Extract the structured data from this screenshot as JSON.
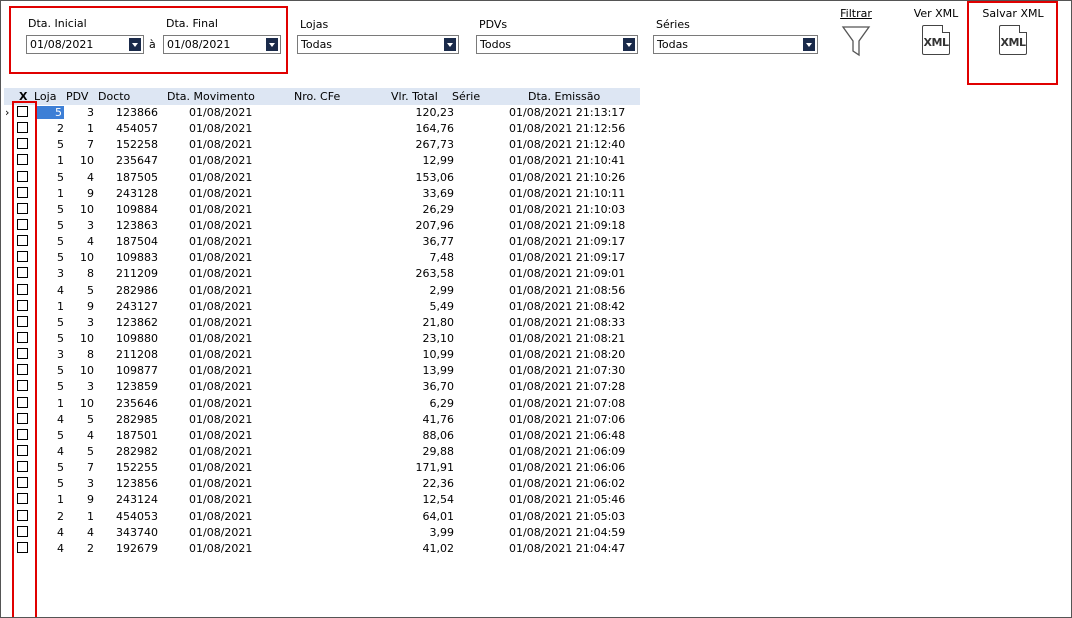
{
  "filters": {
    "dta_inicial_label": "Dta. Inicial",
    "dta_inicial_value": "01/08/2021",
    "separator": "à",
    "dta_final_label": "Dta. Final",
    "dta_final_value": "01/08/2021",
    "lojas_label": "Lojas",
    "lojas_value": "Todas",
    "pdvs_label": "PDVs",
    "pdvs_value": "Todos",
    "series_label": "Séries",
    "series_value": "Todas"
  },
  "toolbar": {
    "filtrar": "Filtrar",
    "ver_xml": "Ver XML",
    "salvar_xml": "Salvar XML",
    "icon_text": "XML"
  },
  "grid": {
    "headers": {
      "x": "X",
      "loja": "Loja",
      "pdv": "PDV",
      "docto": "Docto",
      "dta_movimento": "Dta. Movimento",
      "nro_cfe": "Nro. CFe",
      "vlr_total": "Vlr. Total",
      "serie": "Série",
      "dta_emissao": "Dta. Emissão"
    },
    "rows": [
      {
        "loja": "5",
        "pdv": "3",
        "docto": "123866",
        "mov": "01/08/2021",
        "total": "120,23",
        "emissao": "01/08/2021 21:13:17"
      },
      {
        "loja": "2",
        "pdv": "1",
        "docto": "454057",
        "mov": "01/08/2021",
        "total": "164,76",
        "emissao": "01/08/2021 21:12:56"
      },
      {
        "loja": "5",
        "pdv": "7",
        "docto": "152258",
        "mov": "01/08/2021",
        "total": "267,73",
        "emissao": "01/08/2021 21:12:40"
      },
      {
        "loja": "1",
        "pdv": "10",
        "docto": "235647",
        "mov": "01/08/2021",
        "total": "12,99",
        "emissao": "01/08/2021 21:10:41"
      },
      {
        "loja": "5",
        "pdv": "4",
        "docto": "187505",
        "mov": "01/08/2021",
        "total": "153,06",
        "emissao": "01/08/2021 21:10:26"
      },
      {
        "loja": "1",
        "pdv": "9",
        "docto": "243128",
        "mov": "01/08/2021",
        "total": "33,69",
        "emissao": "01/08/2021 21:10:11"
      },
      {
        "loja": "5",
        "pdv": "10",
        "docto": "109884",
        "mov": "01/08/2021",
        "total": "26,29",
        "emissao": "01/08/2021 21:10:03"
      },
      {
        "loja": "5",
        "pdv": "3",
        "docto": "123863",
        "mov": "01/08/2021",
        "total": "207,96",
        "emissao": "01/08/2021 21:09:18"
      },
      {
        "loja": "5",
        "pdv": "4",
        "docto": "187504",
        "mov": "01/08/2021",
        "total": "36,77",
        "emissao": "01/08/2021 21:09:17"
      },
      {
        "loja": "5",
        "pdv": "10",
        "docto": "109883",
        "mov": "01/08/2021",
        "total": "7,48",
        "emissao": "01/08/2021 21:09:17"
      },
      {
        "loja": "3",
        "pdv": "8",
        "docto": "211209",
        "mov": "01/08/2021",
        "total": "263,58",
        "emissao": "01/08/2021 21:09:01"
      },
      {
        "loja": "4",
        "pdv": "5",
        "docto": "282986",
        "mov": "01/08/2021",
        "total": "2,99",
        "emissao": "01/08/2021 21:08:56"
      },
      {
        "loja": "1",
        "pdv": "9",
        "docto": "243127",
        "mov": "01/08/2021",
        "total": "5,49",
        "emissao": "01/08/2021 21:08:42"
      },
      {
        "loja": "5",
        "pdv": "3",
        "docto": "123862",
        "mov": "01/08/2021",
        "total": "21,80",
        "emissao": "01/08/2021 21:08:33"
      },
      {
        "loja": "5",
        "pdv": "10",
        "docto": "109880",
        "mov": "01/08/2021",
        "total": "23,10",
        "emissao": "01/08/2021 21:08:21"
      },
      {
        "loja": "3",
        "pdv": "8",
        "docto": "211208",
        "mov": "01/08/2021",
        "total": "10,99",
        "emissao": "01/08/2021 21:08:20"
      },
      {
        "loja": "5",
        "pdv": "10",
        "docto": "109877",
        "mov": "01/08/2021",
        "total": "13,99",
        "emissao": "01/08/2021 21:07:30"
      },
      {
        "loja": "5",
        "pdv": "3",
        "docto": "123859",
        "mov": "01/08/2021",
        "total": "36,70",
        "emissao": "01/08/2021 21:07:28"
      },
      {
        "loja": "1",
        "pdv": "10",
        "docto": "235646",
        "mov": "01/08/2021",
        "total": "6,29",
        "emissao": "01/08/2021 21:07:08"
      },
      {
        "loja": "4",
        "pdv": "5",
        "docto": "282985",
        "mov": "01/08/2021",
        "total": "41,76",
        "emissao": "01/08/2021 21:07:06"
      },
      {
        "loja": "5",
        "pdv": "4",
        "docto": "187501",
        "mov": "01/08/2021",
        "total": "88,06",
        "emissao": "01/08/2021 21:06:48"
      },
      {
        "loja": "4",
        "pdv": "5",
        "docto": "282982",
        "mov": "01/08/2021",
        "total": "29,88",
        "emissao": "01/08/2021 21:06:09"
      },
      {
        "loja": "5",
        "pdv": "7",
        "docto": "152255",
        "mov": "01/08/2021",
        "total": "171,91",
        "emissao": "01/08/2021 21:06:06"
      },
      {
        "loja": "5",
        "pdv": "3",
        "docto": "123856",
        "mov": "01/08/2021",
        "total": "22,36",
        "emissao": "01/08/2021 21:06:02"
      },
      {
        "loja": "1",
        "pdv": "9",
        "docto": "243124",
        "mov": "01/08/2021",
        "total": "12,54",
        "emissao": "01/08/2021 21:05:46"
      },
      {
        "loja": "2",
        "pdv": "1",
        "docto": "454053",
        "mov": "01/08/2021",
        "total": "64,01",
        "emissao": "01/08/2021 21:05:03"
      },
      {
        "loja": "4",
        "pdv": "4",
        "docto": "343740",
        "mov": "01/08/2021",
        "total": "3,99",
        "emissao": "01/08/2021 21:04:59"
      },
      {
        "loja": "4",
        "pdv": "2",
        "docto": "192679",
        "mov": "01/08/2021",
        "total": "41,02",
        "emissao": "01/08/2021 21:04:47"
      }
    ]
  },
  "colors": {
    "highlight": "#e00000",
    "header_bg": "#dde6f3",
    "selected_cell": "#3d7fd6"
  }
}
